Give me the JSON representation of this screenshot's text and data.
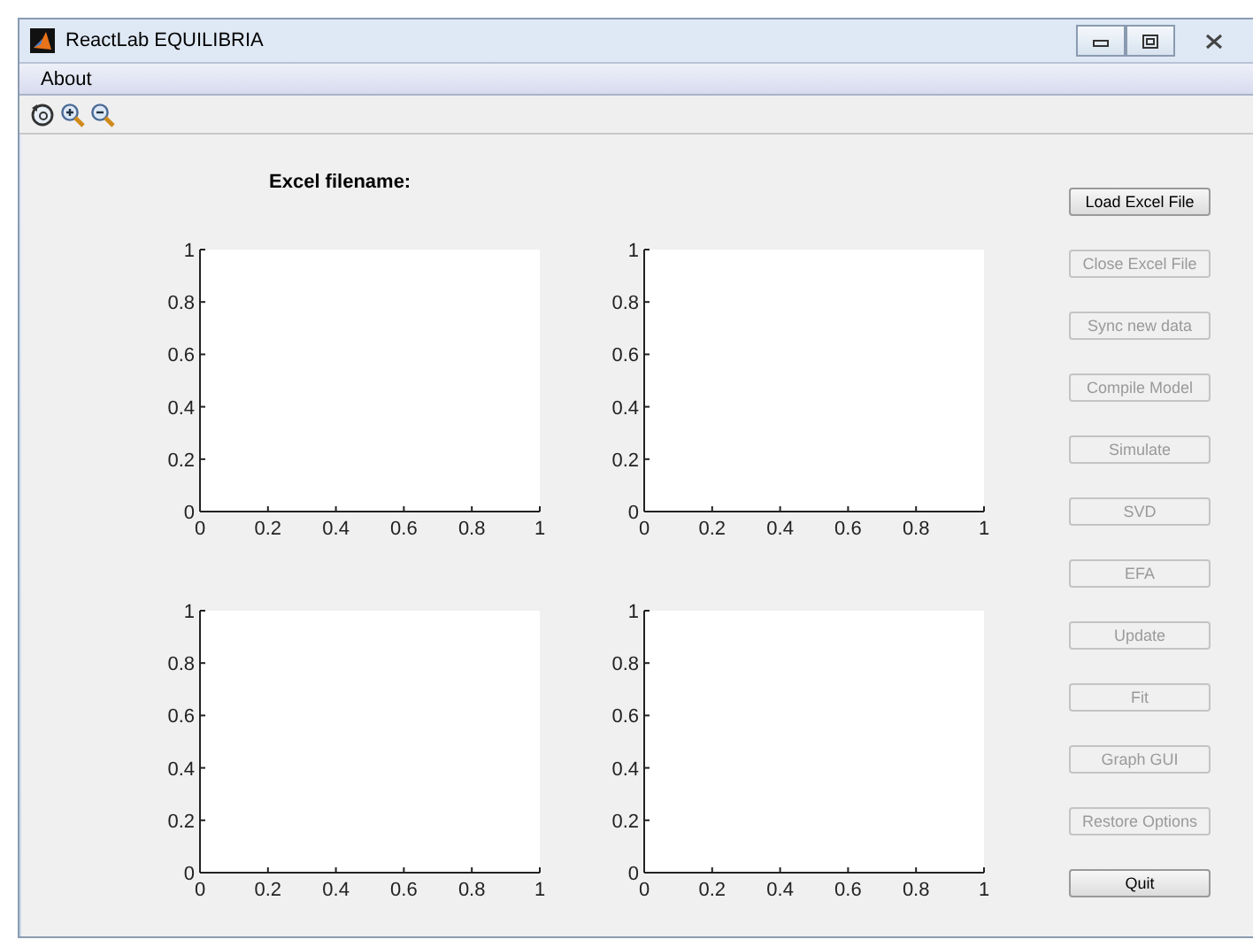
{
  "window": {
    "title": "ReactLab EQUILIBRIA"
  },
  "menu": [
    {
      "label": "About"
    }
  ],
  "toolbar": [
    {
      "kind": "rotate"
    },
    {
      "kind": "zoom-in"
    },
    {
      "kind": "zoom-out"
    }
  ],
  "filename_label": "Excel filename:",
  "axes": [
    {
      "chart_data": {
        "type": "line",
        "xlim": [
          0,
          1
        ],
        "ylim": [
          0,
          1
        ],
        "xticks": [
          0,
          0.2,
          0.4,
          0.6,
          0.8,
          1
        ],
        "yticks": [
          0,
          0.2,
          0.4,
          0.6,
          0.8,
          1
        ]
      }
    },
    {
      "chart_data": {
        "type": "line",
        "xlim": [
          0,
          1
        ],
        "ylim": [
          0,
          1
        ],
        "xticks": [
          0,
          0.2,
          0.4,
          0.6,
          0.8,
          1
        ],
        "yticks": [
          0,
          0.2,
          0.4,
          0.6,
          0.8,
          1
        ]
      }
    },
    {
      "chart_data": {
        "type": "line",
        "xlim": [
          0,
          1
        ],
        "ylim": [
          0,
          1
        ],
        "xticks": [
          0,
          0.2,
          0.4,
          0.6,
          0.8,
          1
        ],
        "yticks": [
          0,
          0.2,
          0.4,
          0.6,
          0.8,
          1
        ]
      }
    },
    {
      "chart_data": {
        "type": "line",
        "xlim": [
          0,
          1
        ],
        "ylim": [
          0,
          1
        ],
        "xticks": [
          0,
          0.2,
          0.4,
          0.6,
          0.8,
          1
        ],
        "yticks": [
          0,
          0.2,
          0.4,
          0.6,
          0.8,
          1
        ]
      }
    }
  ],
  "buttons": [
    {
      "label": "Load Excel File",
      "disabled": false
    },
    {
      "label": "Close Excel File",
      "disabled": true
    },
    {
      "label": "Sync new data",
      "disabled": true
    },
    {
      "label": "Compile Model",
      "disabled": true
    },
    {
      "label": "Simulate",
      "disabled": true
    },
    {
      "label": "SVD",
      "disabled": true
    },
    {
      "label": "EFA",
      "disabled": true
    },
    {
      "label": "Update",
      "disabled": true
    },
    {
      "label": "Fit",
      "disabled": true
    },
    {
      "label": "Graph GUI",
      "disabled": true
    },
    {
      "label": "Restore Options",
      "disabled": true
    },
    {
      "label": "Quit",
      "disabled": false
    }
  ]
}
